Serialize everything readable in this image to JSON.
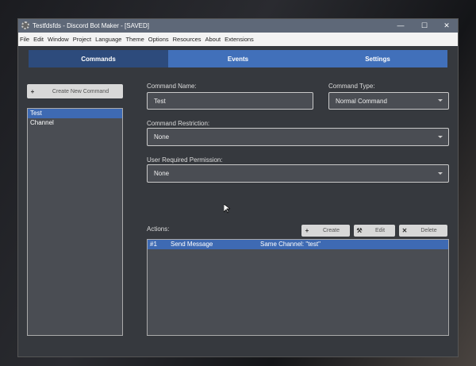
{
  "window": {
    "title": "Testfdsfds - Discord Bot Maker - [SAVED]",
    "controls": [
      "—",
      "☐",
      "✕"
    ]
  },
  "menu": [
    "File",
    "Edit",
    "Window",
    "Project",
    "Language",
    "Theme",
    "Options",
    "Resources",
    "About",
    "Extensions"
  ],
  "tabs": [
    {
      "label": "Commands",
      "active": true
    },
    {
      "label": "Events"
    },
    {
      "label": "Settings"
    }
  ],
  "sidebar": {
    "create_label": "Create New Command",
    "create_icon": "+",
    "items": [
      "Test",
      "Channel"
    ],
    "selected": "Test"
  },
  "form": {
    "name_label": "Command Name:",
    "name_value": "Test",
    "type_label": "Command Type:",
    "type_value": "Normal Command",
    "restriction_label": "Command Restriction:",
    "restriction_value": "None",
    "permission_label": "User Required Permission:",
    "permission_value": "None"
  },
  "actions": {
    "label": "Actions:",
    "create": "Create",
    "edit": "Edit",
    "delete": "Delete",
    "rows": [
      {
        "num": "#1",
        "name": "Send Message",
        "detail": "Same Channel: \"test\""
      }
    ]
  }
}
